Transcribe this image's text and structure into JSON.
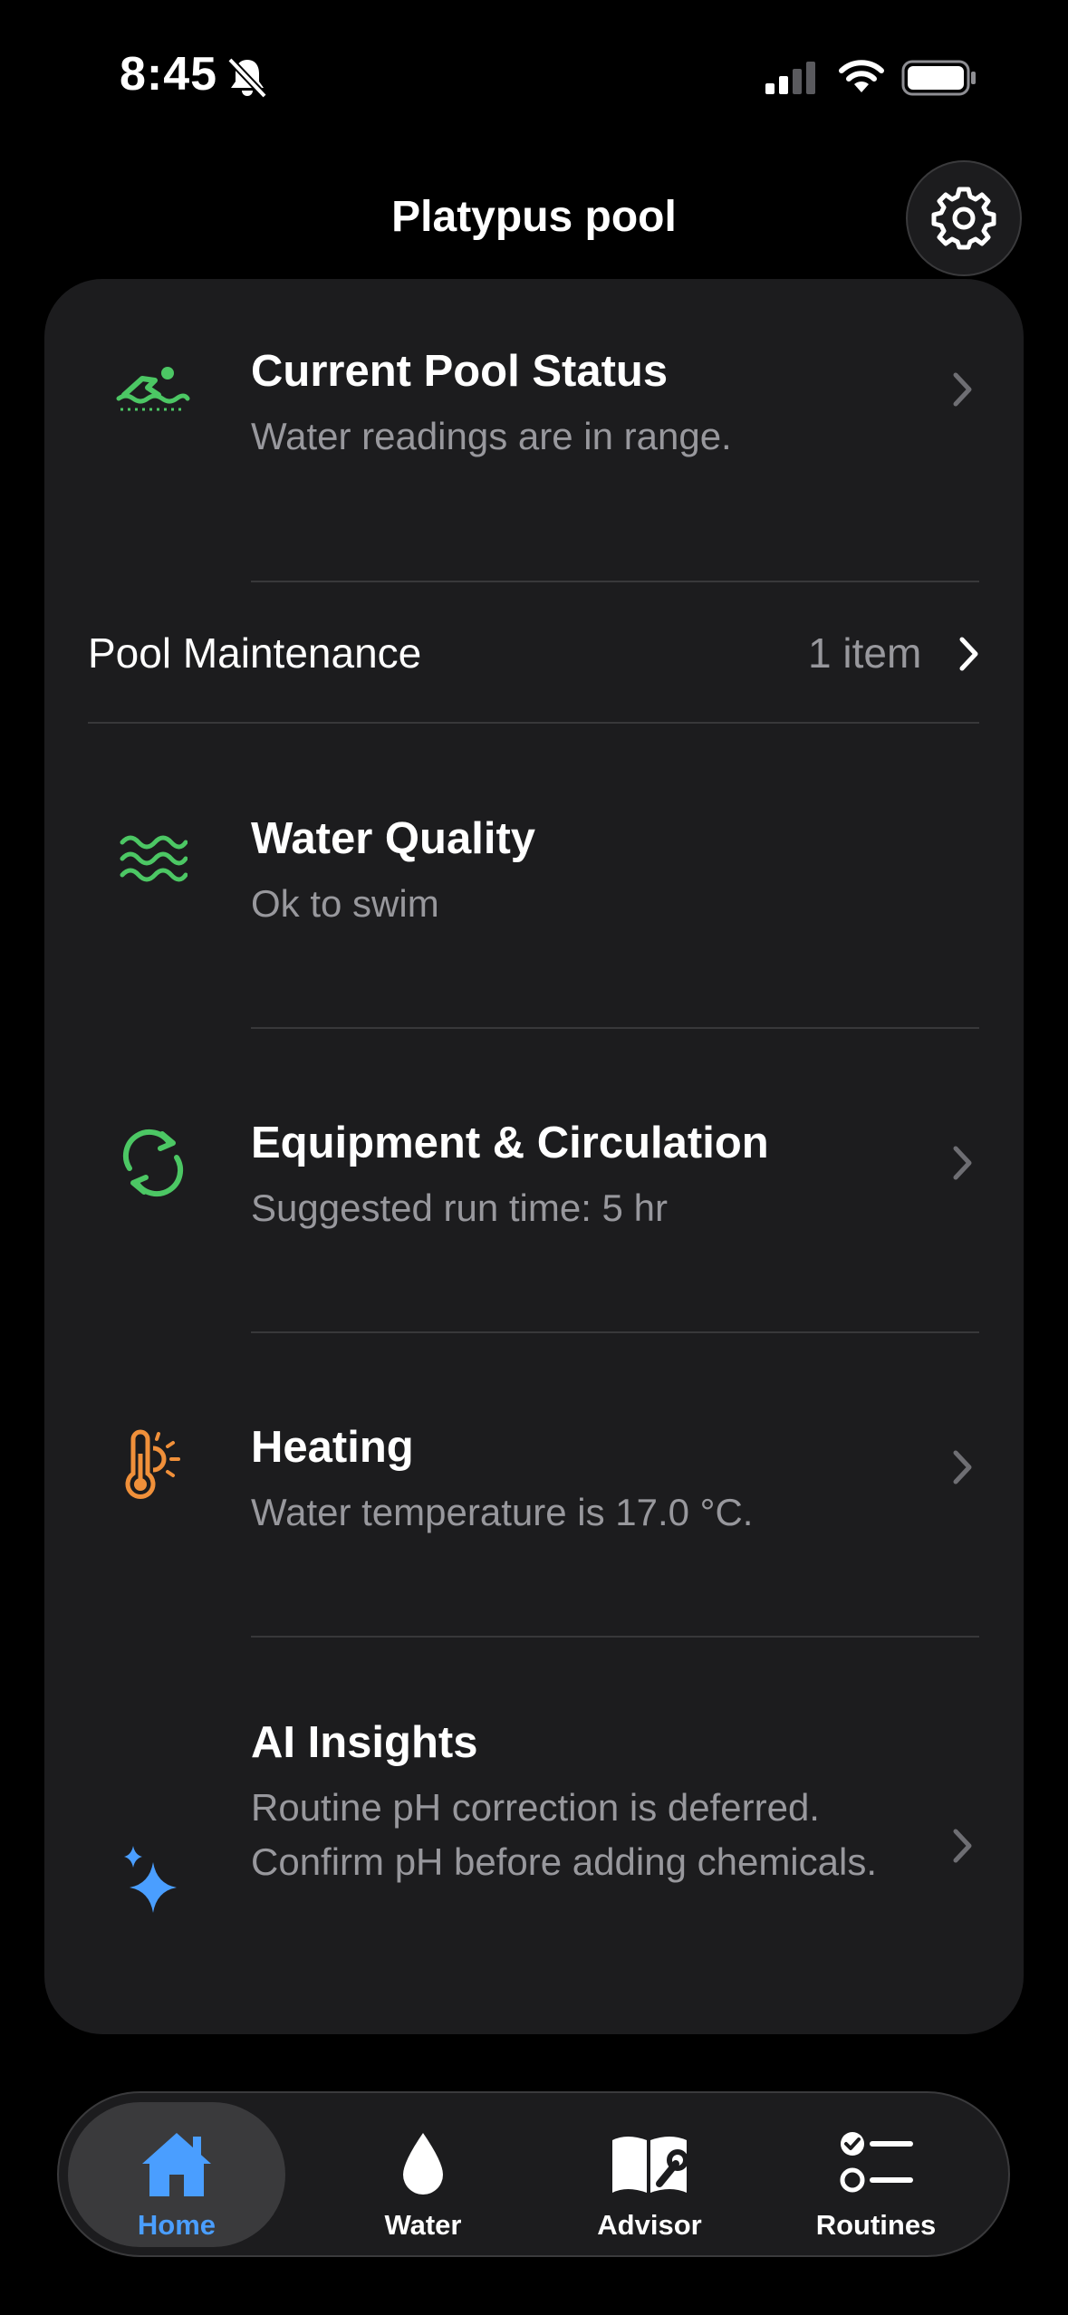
{
  "status_bar": {
    "time": "8:45",
    "icons": [
      "bell-slash-icon",
      "signal-icon",
      "wifi-icon",
      "battery-icon"
    ]
  },
  "header": {
    "title": "Platypus pool",
    "settings_icon": "gear-icon"
  },
  "pool_status": {
    "title": "Current Pool Status",
    "subtitle": "Water readings are in range.",
    "icon": "swimmer-icon"
  },
  "maintenance": {
    "label": "Pool Maintenance",
    "count": "1 item"
  },
  "water_quality": {
    "title": "Water Quality",
    "subtitle": "Ok to swim",
    "icon": "water-waves-icon"
  },
  "equipment": {
    "title": "Equipment & Circulation",
    "subtitle": "Suggested run time: 5 hr",
    "icon": "circulation-arrows-icon"
  },
  "heating": {
    "title": "Heating",
    "subtitle": "Water temperature is 17.0 °C.",
    "icon": "thermometer-sun-icon"
  },
  "ai_insights": {
    "title": "AI Insights",
    "subtitle": "Routine pH correction is deferred. Confirm pH before adding chemicals.",
    "icon": "sparkles-icon"
  },
  "tabs": [
    {
      "label": "Home",
      "icon": "house-icon",
      "active": true
    },
    {
      "label": "Water",
      "icon": "drop-icon",
      "active": false
    },
    {
      "label": "Advisor",
      "icon": "book-wrench-icon",
      "active": false
    },
    {
      "label": "Routines",
      "icon": "checklist-icon",
      "active": false
    }
  ],
  "colors": {
    "background": "#000000",
    "card": "#1c1c1e",
    "green": "#4cc764",
    "orange": "#f0903a",
    "blue": "#4a9eff",
    "secondary_text": "#98989d"
  }
}
